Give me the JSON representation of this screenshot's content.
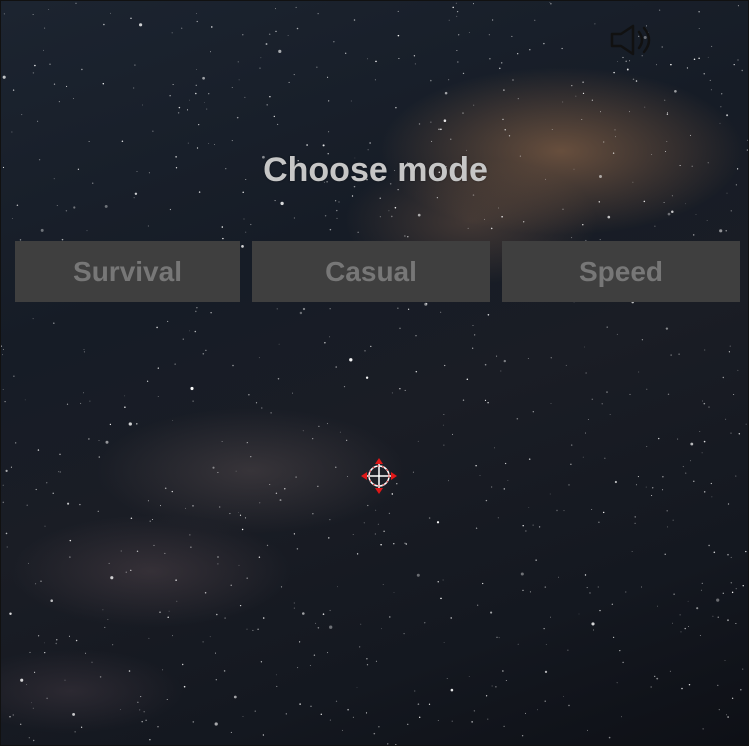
{
  "screen": {
    "title": "Choose mode"
  },
  "modes": [
    {
      "label": "Survival"
    },
    {
      "label": "Casual"
    },
    {
      "label": "Speed"
    }
  ],
  "icons": {
    "sound": "speaker-icon",
    "cursor": "crosshair-cursor-icon"
  },
  "colors": {
    "button_bg": "#3f3f3f",
    "button_text": "#777777",
    "title_text": "#c6c6c6",
    "cursor_red": "#e01818"
  }
}
